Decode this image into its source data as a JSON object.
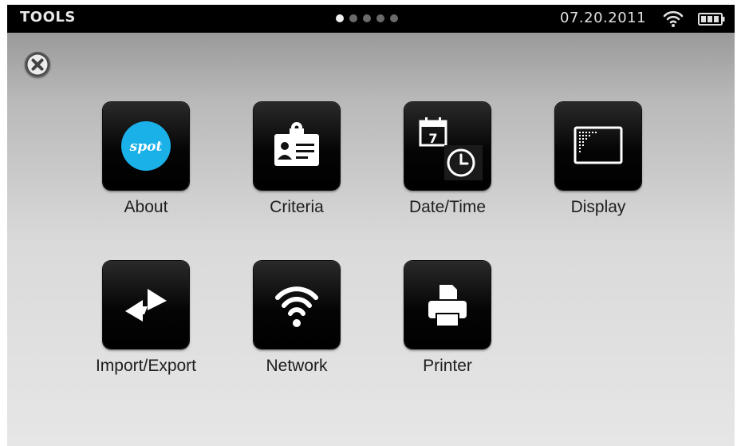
{
  "status_bar": {
    "title": "TOOLS",
    "date": "07.20.2011",
    "page_count": 5,
    "active_page": 1,
    "wifi_icon": "wifi-icon",
    "battery_icon": "battery-icon"
  },
  "close_button": {
    "icon": "close-icon"
  },
  "tools": [
    {
      "label": "About",
      "icon": "spot-logo-icon",
      "badge_text": "spot",
      "badge_color": "#1ab0e8"
    },
    {
      "label": "Criteria",
      "icon": "id-badge-icon"
    },
    {
      "label": "Date/Time",
      "icon": "calendar-clock-icon",
      "calendar_day": "7"
    },
    {
      "label": "Display",
      "icon": "display-icon"
    },
    {
      "label": "Import/Export",
      "icon": "swap-arrows-icon"
    },
    {
      "label": "Network",
      "icon": "wifi-icon"
    },
    {
      "label": "Printer",
      "icon": "printer-icon"
    }
  ]
}
